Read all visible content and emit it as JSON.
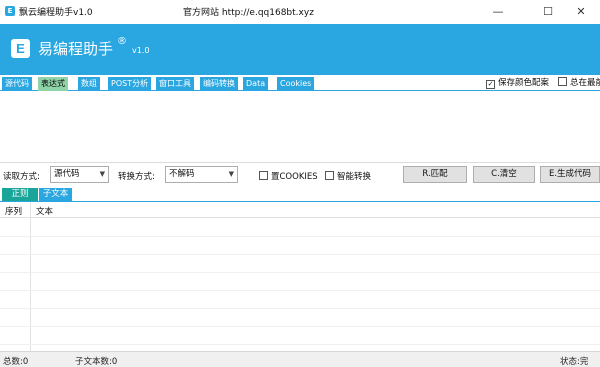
{
  "window": {
    "title": "飘云编程助手v1.0",
    "site": "官方网站 http://e.qq168bt.xyz",
    "icon": "E",
    "controls": {
      "minimize": "—",
      "maximize": "☐",
      "close": "✕"
    }
  },
  "header": {
    "logo": "E",
    "brand": "易编程助手",
    "reg_mark": "®",
    "version": "v1.0"
  },
  "tabs": [
    {
      "label": "源代码"
    },
    {
      "label": "表达式"
    },
    {
      "label": "数组"
    },
    {
      "label": "POST分析"
    },
    {
      "label": "窗口工具"
    },
    {
      "label": "编码转换"
    },
    {
      "label": "Data"
    },
    {
      "label": "Cookies"
    }
  ],
  "options": {
    "save_colors": {
      "label": "保存颜色配案",
      "checked": true
    },
    "always_top": {
      "label": "总在最前",
      "checked": false
    }
  },
  "controls": {
    "read_label": "读取方式:",
    "read_value": "源代码",
    "convert_label": "转换方式:",
    "convert_value": "不解码",
    "cookies_label": "置COOKIES",
    "smart_label": "智能转换",
    "match_btn": "R.匹配",
    "clear_btn": "C.清空",
    "gen_btn": "E.生成代码"
  },
  "result_tabs": [
    {
      "label": "正则"
    },
    {
      "label": "子文本"
    }
  ],
  "grid": {
    "columns": [
      "序列",
      "文本"
    ]
  },
  "status": {
    "total": "总数:0",
    "sub_total": "子文本数:0",
    "state": "状态:完"
  },
  "colors": {
    "accent": "#2aa6e0",
    "active_tab": "#8fd3a8",
    "active_result_tab": "#1aa59a"
  }
}
